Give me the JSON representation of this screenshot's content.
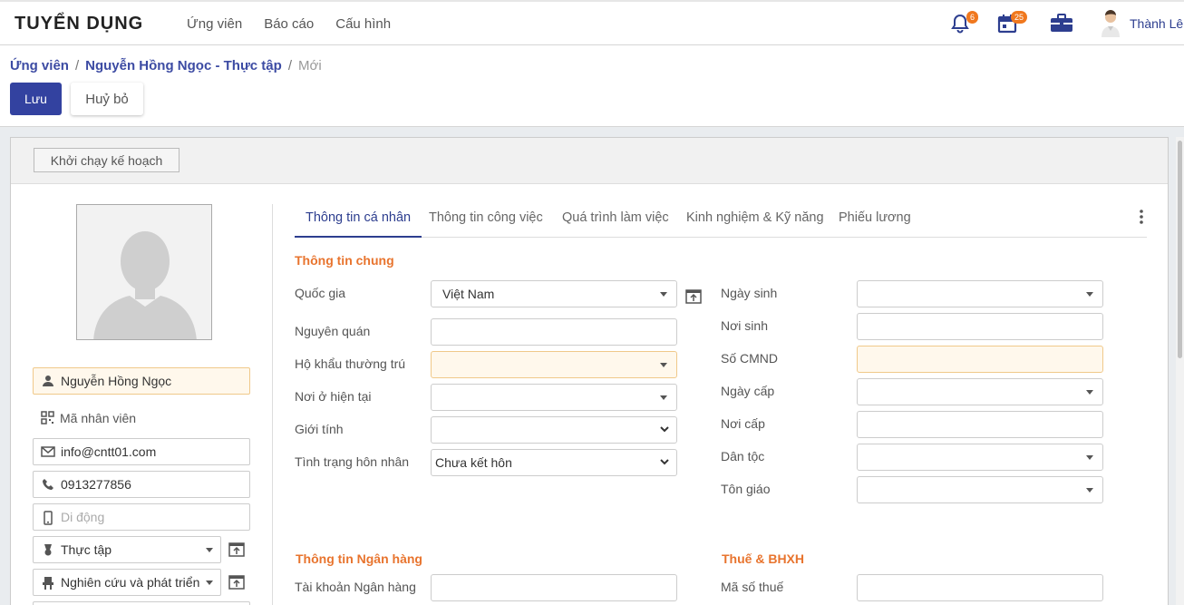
{
  "app": {
    "brand": "TUYỂN DỤNG",
    "accent": "#2d3e8f",
    "section_color": "#e8742e"
  },
  "nav": {
    "items": [
      "Ứng viên",
      "Báo cáo",
      "Cấu hình"
    ]
  },
  "systray": {
    "notif_count": "6",
    "calendar_count": "25",
    "user_name": "Thành Lê"
  },
  "breadcrumb": {
    "root": "Ứng viên",
    "parent": "Nguyễn Hồng Ngọc - Thực tập",
    "current": "Mới"
  },
  "actions": {
    "save": "Lưu",
    "cancel": "Huỷ bỏ"
  },
  "sheet": {
    "launch_plan": "Khởi chạy kế hoạch"
  },
  "left": {
    "name": "Nguyễn Hồng Ngọc",
    "employee_code": "Mã nhân viên",
    "email": "info@cntt01.com",
    "phone": "0913277856",
    "mobile_placeholder": "Di động",
    "job": "Thực tập",
    "department": "Nghiên cứu và phát triển"
  },
  "tabs": [
    "Thông tin cá nhân",
    "Thông tin công việc",
    "Quá trình làm việc",
    "Kinh nghiệm & Kỹ năng",
    "Phiếu lương"
  ],
  "general": {
    "title": "Thông tin chung",
    "country_label": "Quốc gia",
    "country_value": "Việt Nam",
    "origin_label": "Nguyên quán",
    "household_label": "Hộ khẩu thường trú",
    "residence_label": "Nơi ở hiện tại",
    "gender_label": "Giới tính",
    "marital_label": "Tình trạng hôn nhân",
    "marital_value": "Chưa kết hôn",
    "birthday_label": "Ngày sinh",
    "birthplace_label": "Nơi sinh",
    "id_label": "Số CMND",
    "issue_date_label": "Ngày cấp",
    "issue_place_label": "Nơi cấp",
    "ethnicity_label": "Dân tộc",
    "religion_label": "Tôn giáo"
  },
  "bank": {
    "title": "Thông tin Ngân hàng",
    "account_label": "Tài khoản Ngân hàng"
  },
  "tax": {
    "title": "Thuế & BHXH",
    "tax_code_label": "Mã số thuế"
  }
}
